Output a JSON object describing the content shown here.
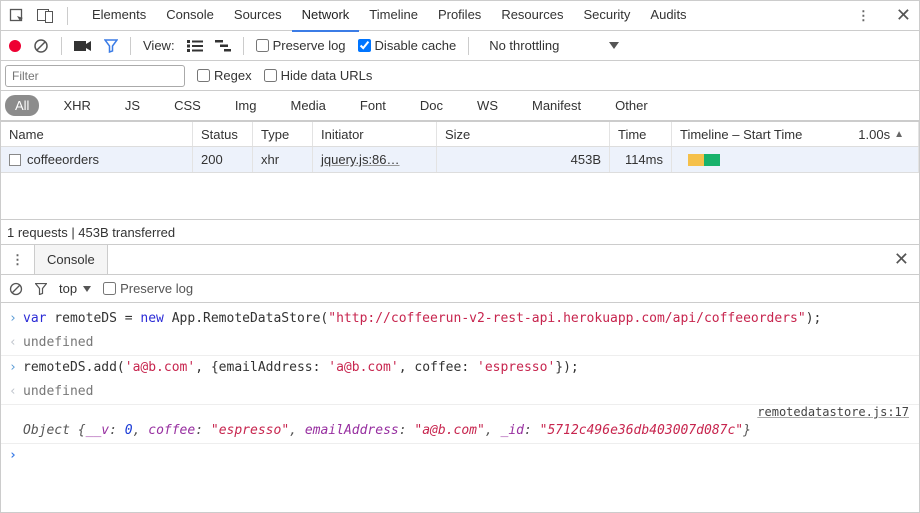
{
  "tabs": {
    "items": [
      "Elements",
      "Console",
      "Sources",
      "Network",
      "Timeline",
      "Profiles",
      "Resources",
      "Security",
      "Audits"
    ],
    "active": "Network"
  },
  "toolbar": {
    "view_label": "View:",
    "preserve_log_label": "Preserve log",
    "preserve_log_checked": false,
    "disable_cache_label": "Disable cache",
    "disable_cache_checked": true,
    "throttling_label": "No throttling"
  },
  "filterbar": {
    "placeholder": "Filter",
    "value": "",
    "regex_label": "Regex",
    "hide_data_urls_label": "Hide data URLs"
  },
  "typebar": {
    "items": [
      "All",
      "XHR",
      "JS",
      "CSS",
      "Img",
      "Media",
      "Font",
      "Doc",
      "WS",
      "Manifest",
      "Other"
    ],
    "active": "All"
  },
  "table": {
    "headers": {
      "name": "Name",
      "status": "Status",
      "type": "Type",
      "initiator": "Initiator",
      "size": "Size",
      "time": "Time",
      "timeline": "Timeline – Start Time",
      "scale": "1.00s"
    },
    "rows": [
      {
        "name": "coffeeorders",
        "status": "200",
        "type": "xhr",
        "initiator": "jquery.js:86…",
        "size": "453B",
        "time": "114ms"
      }
    ]
  },
  "summary": "1 requests | 453B transferred",
  "drawer": {
    "tab": "Console"
  },
  "console_toolbar": {
    "context": "top",
    "preserve_log_label": "Preserve log"
  },
  "console": {
    "line1_pre": "var",
    "line1_var": " remoteDS = ",
    "line1_new": "new",
    "line1_call": " App.RemoteDataStore(",
    "line1_str": "\"http://coffeerun-v2-rest-api.herokuapp.com/api/coffeeorders\"",
    "line1_end": ");",
    "undef1": "undefined",
    "line2_pre": "remoteDS.add(",
    "line2_s1": "'a@b.com'",
    "line2_mid": ", {emailAddress: ",
    "line2_s2": "'a@b.com'",
    "line2_mid2": ", coffee: ",
    "line2_s3": "'espresso'",
    "line2_end": "});",
    "undef2": "undefined",
    "log_origin": "remotedatastore.js:17",
    "obj_label": "Object ",
    "obj_open": "{",
    "obj_k1": "__v",
    "obj_c": ": ",
    "obj_v1": "0",
    "obj_sep": ", ",
    "obj_k2": "coffee",
    "obj_v2": "\"espresso\"",
    "obj_k3": "emailAddress",
    "obj_v3": "\"a@b.com\"",
    "obj_k4": "_id",
    "obj_v4": "\"5712c496e36db403007d087c\"",
    "obj_close": "}"
  }
}
